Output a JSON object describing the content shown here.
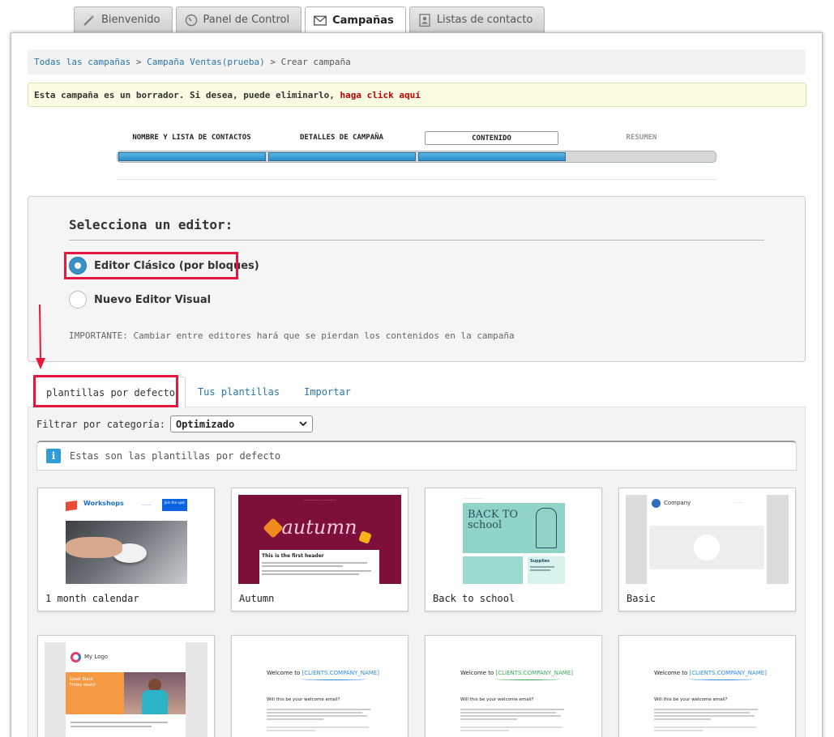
{
  "top_tabs": [
    {
      "label": "Bienvenido",
      "icon": "wand-icon"
    },
    {
      "label": "Panel de Control",
      "icon": "gauge-icon"
    },
    {
      "label": "Campañas",
      "icon": "envelope-icon",
      "active": true
    },
    {
      "label": "Listas de contacto",
      "icon": "contacts-icon"
    }
  ],
  "breadcrumb": {
    "item1": "Todas las campañas",
    "sep": ">",
    "item2": "Campaña Ventas(prueba)",
    "current": "Crear campaña"
  },
  "draft_notice": {
    "text": "Esta campaña es un borrador. Si desea, puede eliminarlo,",
    "link": "haga click aquí"
  },
  "steps": [
    {
      "label": "NOMBRE Y LISTA DE CONTACTOS",
      "state": "done"
    },
    {
      "label": "DETALLES DE CAMPAÑA",
      "state": "done"
    },
    {
      "label": "CONTENIDO",
      "state": "current"
    },
    {
      "label": "RESUMEN",
      "state": "pending"
    }
  ],
  "editor": {
    "title": "Selecciona un editor:",
    "option_classic": "Editor Clásico (por bloques)",
    "option_visual": "Nuevo Editor Visual",
    "selected": "classic",
    "note": "IMPORTANTE: Cambiar entre editores hará que se pierdan los contenidos en la campaña"
  },
  "template_tabs": {
    "default": "plantillas por defecto",
    "yours": "Tus plantillas",
    "import": "Importar"
  },
  "filter": {
    "label": "Filtrar por categoría:",
    "selected": "Optimizado"
  },
  "info": {
    "text": "Estas son las plantillas por defecto"
  },
  "templates": [
    {
      "name": "1 month calendar",
      "thumb_text": "Workshops",
      "thumb_button": "Join the spot"
    },
    {
      "name": "Autumn",
      "thumb_text": "autumn",
      "thumb_header": "This is the first header"
    },
    {
      "name": "Back to school",
      "thumb_text": "BACK TO school",
      "thumb_side": "Supplies"
    },
    {
      "name": "Basic",
      "thumb_text": "Company"
    },
    {
      "name": "",
      "thumb_text": "My Logo",
      "thumb_promo": "Great Black Friday deals!"
    },
    {
      "name": "",
      "thumb_text": "Welcome to",
      "thumb_var": "[CLIENTS.COMPANY_NAME]",
      "thumb_q": "Will this be your welcome email?"
    },
    {
      "name": "",
      "thumb_text": "Welcome to",
      "thumb_var": "[CLIENTS.COMPANY_NAME]",
      "thumb_q": "Will this be your welcome email?"
    },
    {
      "name": "",
      "thumb_text": "Welcome to",
      "thumb_var": "[CLIENTS.COMPANY_NAME]",
      "thumb_q": "Will this be your welcome email?"
    }
  ],
  "colors": {
    "link": "#2a76a8",
    "highlight": "#e8163c",
    "progress": "#2a8fca",
    "autumn_bg": "#7d0f3a",
    "promo": "#f59a42"
  }
}
